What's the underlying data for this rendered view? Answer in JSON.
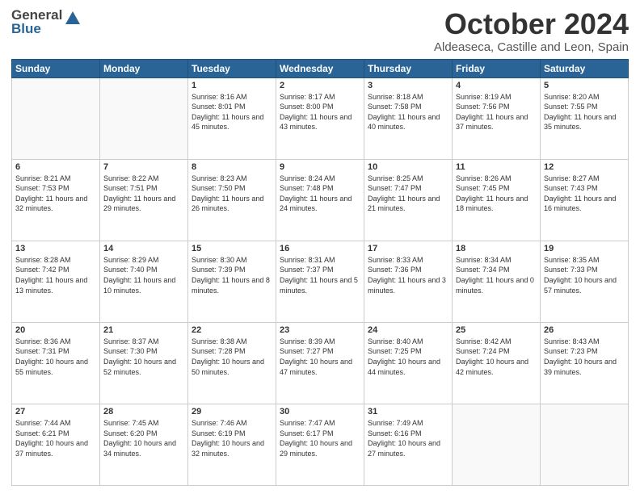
{
  "header": {
    "logo_line1": "General",
    "logo_line2": "Blue",
    "month_title": "October 2024",
    "location": "Aldeaseca, Castille and Leon, Spain"
  },
  "weekdays": [
    "Sunday",
    "Monday",
    "Tuesday",
    "Wednesday",
    "Thursday",
    "Friday",
    "Saturday"
  ],
  "weeks": [
    [
      {
        "day": "",
        "details": ""
      },
      {
        "day": "",
        "details": ""
      },
      {
        "day": "1",
        "details": "Sunrise: 8:16 AM\nSunset: 8:01 PM\nDaylight: 11 hours and 45 minutes."
      },
      {
        "day": "2",
        "details": "Sunrise: 8:17 AM\nSunset: 8:00 PM\nDaylight: 11 hours and 43 minutes."
      },
      {
        "day": "3",
        "details": "Sunrise: 8:18 AM\nSunset: 7:58 PM\nDaylight: 11 hours and 40 minutes."
      },
      {
        "day": "4",
        "details": "Sunrise: 8:19 AM\nSunset: 7:56 PM\nDaylight: 11 hours and 37 minutes."
      },
      {
        "day": "5",
        "details": "Sunrise: 8:20 AM\nSunset: 7:55 PM\nDaylight: 11 hours and 35 minutes."
      }
    ],
    [
      {
        "day": "6",
        "details": "Sunrise: 8:21 AM\nSunset: 7:53 PM\nDaylight: 11 hours and 32 minutes."
      },
      {
        "day": "7",
        "details": "Sunrise: 8:22 AM\nSunset: 7:51 PM\nDaylight: 11 hours and 29 minutes."
      },
      {
        "day": "8",
        "details": "Sunrise: 8:23 AM\nSunset: 7:50 PM\nDaylight: 11 hours and 26 minutes."
      },
      {
        "day": "9",
        "details": "Sunrise: 8:24 AM\nSunset: 7:48 PM\nDaylight: 11 hours and 24 minutes."
      },
      {
        "day": "10",
        "details": "Sunrise: 8:25 AM\nSunset: 7:47 PM\nDaylight: 11 hours and 21 minutes."
      },
      {
        "day": "11",
        "details": "Sunrise: 8:26 AM\nSunset: 7:45 PM\nDaylight: 11 hours and 18 minutes."
      },
      {
        "day": "12",
        "details": "Sunrise: 8:27 AM\nSunset: 7:43 PM\nDaylight: 11 hours and 16 minutes."
      }
    ],
    [
      {
        "day": "13",
        "details": "Sunrise: 8:28 AM\nSunset: 7:42 PM\nDaylight: 11 hours and 13 minutes."
      },
      {
        "day": "14",
        "details": "Sunrise: 8:29 AM\nSunset: 7:40 PM\nDaylight: 11 hours and 10 minutes."
      },
      {
        "day": "15",
        "details": "Sunrise: 8:30 AM\nSunset: 7:39 PM\nDaylight: 11 hours and 8 minutes."
      },
      {
        "day": "16",
        "details": "Sunrise: 8:31 AM\nSunset: 7:37 PM\nDaylight: 11 hours and 5 minutes."
      },
      {
        "day": "17",
        "details": "Sunrise: 8:33 AM\nSunset: 7:36 PM\nDaylight: 11 hours and 3 minutes."
      },
      {
        "day": "18",
        "details": "Sunrise: 8:34 AM\nSunset: 7:34 PM\nDaylight: 11 hours and 0 minutes."
      },
      {
        "day": "19",
        "details": "Sunrise: 8:35 AM\nSunset: 7:33 PM\nDaylight: 10 hours and 57 minutes."
      }
    ],
    [
      {
        "day": "20",
        "details": "Sunrise: 8:36 AM\nSunset: 7:31 PM\nDaylight: 10 hours and 55 minutes."
      },
      {
        "day": "21",
        "details": "Sunrise: 8:37 AM\nSunset: 7:30 PM\nDaylight: 10 hours and 52 minutes."
      },
      {
        "day": "22",
        "details": "Sunrise: 8:38 AM\nSunset: 7:28 PM\nDaylight: 10 hours and 50 minutes."
      },
      {
        "day": "23",
        "details": "Sunrise: 8:39 AM\nSunset: 7:27 PM\nDaylight: 10 hours and 47 minutes."
      },
      {
        "day": "24",
        "details": "Sunrise: 8:40 AM\nSunset: 7:25 PM\nDaylight: 10 hours and 44 minutes."
      },
      {
        "day": "25",
        "details": "Sunrise: 8:42 AM\nSunset: 7:24 PM\nDaylight: 10 hours and 42 minutes."
      },
      {
        "day": "26",
        "details": "Sunrise: 8:43 AM\nSunset: 7:23 PM\nDaylight: 10 hours and 39 minutes."
      }
    ],
    [
      {
        "day": "27",
        "details": "Sunrise: 7:44 AM\nSunset: 6:21 PM\nDaylight: 10 hours and 37 minutes."
      },
      {
        "day": "28",
        "details": "Sunrise: 7:45 AM\nSunset: 6:20 PM\nDaylight: 10 hours and 34 minutes."
      },
      {
        "day": "29",
        "details": "Sunrise: 7:46 AM\nSunset: 6:19 PM\nDaylight: 10 hours and 32 minutes."
      },
      {
        "day": "30",
        "details": "Sunrise: 7:47 AM\nSunset: 6:17 PM\nDaylight: 10 hours and 29 minutes."
      },
      {
        "day": "31",
        "details": "Sunrise: 7:49 AM\nSunset: 6:16 PM\nDaylight: 10 hours and 27 minutes."
      },
      {
        "day": "",
        "details": ""
      },
      {
        "day": "",
        "details": ""
      }
    ]
  ]
}
